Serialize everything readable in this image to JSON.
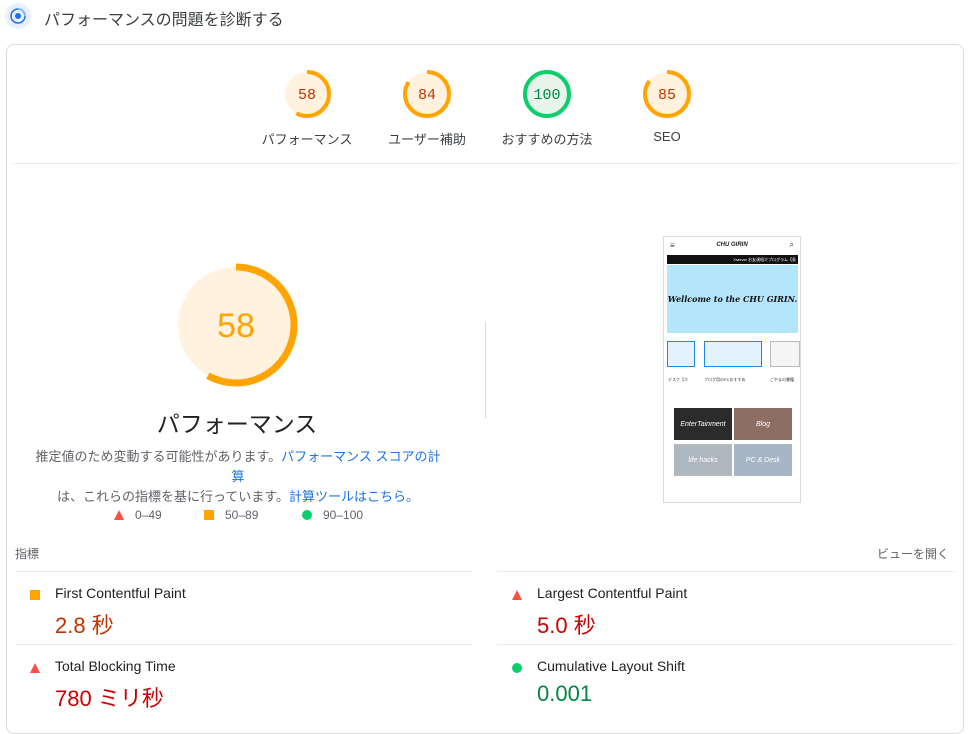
{
  "header": {
    "title": "パフォーマンスの問題を診断する"
  },
  "gauges": [
    {
      "score": "58",
      "label": "パフォーマンス",
      "value": 58,
      "color": "#ffa400",
      "bg": "#fff3e0",
      "text_color": "#c33300"
    },
    {
      "score": "84",
      "label": "ユーザー補助",
      "value": 84,
      "color": "#ffa400",
      "bg": "#fff3e0",
      "text_color": "#c33300"
    },
    {
      "score": "100",
      "label": "おすすめの方法",
      "value": 100,
      "color": "#0cce6b",
      "bg": "#e6f4ea",
      "text_color": "#018642"
    },
    {
      "score": "85",
      "label": "SEO",
      "value": 85,
      "color": "#ffa400",
      "bg": "#fff3e0",
      "text_color": "#c33300"
    }
  ],
  "main": {
    "score": "58",
    "value": 58,
    "label": "パフォーマンス",
    "note_1": "推定値のため変動する可能性があります。",
    "note_link_1": "パフォーマンス スコアの計算",
    "note_2": "は、これらの指標を基に行っています。",
    "note_link_2": "計算ツールはこちら。",
    "legend": [
      {
        "range": "0–49",
        "shape": "triangle",
        "color": "#ff4e42"
      },
      {
        "range": "50–89",
        "shape": "square",
        "color": "#ffa400"
      },
      {
        "range": "90–100",
        "shape": "circle",
        "color": "#0cce6b"
      }
    ]
  },
  "screenshot": {
    "site_title": "CHU GIRIN",
    "ticker": "Xserver お友達紹介プログラム【条",
    "hero_text": "Wellcome to the CHU GIRIN.",
    "card_caption_1": "デスク【ホ",
    "card_caption_2": "ブログ用のPCおすすめ",
    "card_caption_3": "ごやまの書籍",
    "tiles": [
      "EnterTainment",
      "Blog",
      "life hacks",
      "PC & Desk"
    ]
  },
  "metrics": {
    "title": "指標",
    "expand_label": "ビューを開く",
    "items": [
      {
        "name": "First Contentful Paint",
        "value": "2.8 秒",
        "rating": "average",
        "color": "#c33300"
      },
      {
        "name": "Largest Contentful Paint",
        "value": "5.0 秒",
        "rating": "fail",
        "color": "#cc0000"
      },
      {
        "name": "Total Blocking Time",
        "value": "780 ミリ秒",
        "rating": "fail",
        "color": "#cc0000"
      },
      {
        "name": "Cumulative Layout Shift",
        "value": "0.001",
        "rating": "pass",
        "color": "#018642"
      }
    ]
  },
  "colors": {
    "link": "#1a73e8",
    "fail": "#ff4e42",
    "average": "#ffa400",
    "pass": "#0cce6b"
  }
}
